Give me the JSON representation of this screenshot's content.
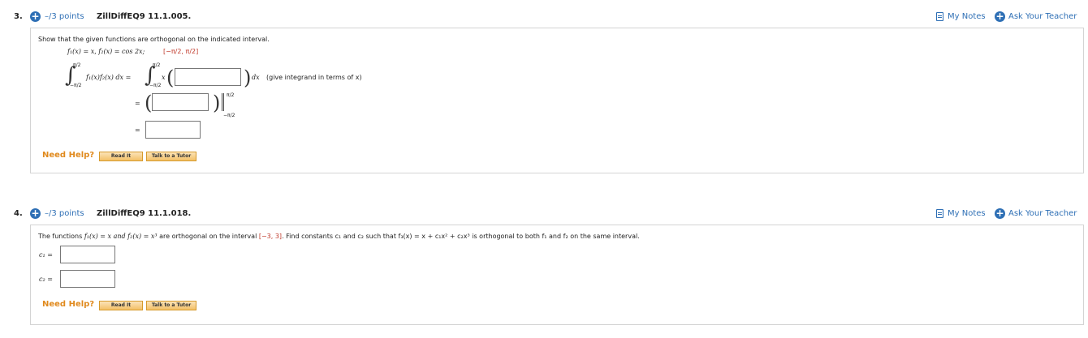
{
  "q3": {
    "number": "3.",
    "points": "–/3 points",
    "code": "ZillDiffEQ9 11.1.005.",
    "my_notes": "My Notes",
    "ask_teacher": "Ask Your Teacher",
    "prompt": "Show that the given functions are orthogonal on the indicated interval.",
    "functions": "f₁(x) = x, f₂(x) = cos 2x;",
    "interval": "[−π/2, π/2]",
    "upper_limit": "π/2",
    "lower_limit": "−π/2",
    "integrand_left": "f₁(x)f₂(x) dx =",
    "x_factor": "x",
    "dx": "dx",
    "hint": "(give integrand in terms of x)",
    "equals": "=",
    "eval_upper": "π/2",
    "eval_lower": "−π/2",
    "need_help": "Need Help?",
    "read_it": "Read It",
    "talk_tutor": "Talk to a Tutor"
  },
  "q4": {
    "number": "4.",
    "points": "–/3 points",
    "code": "ZillDiffEQ9 11.1.018.",
    "my_notes": "My Notes",
    "ask_teacher": "Ask Your Teacher",
    "prompt_a": "The functions ",
    "prompt_b": "f₁(x) = x and f₂(x) = x³",
    "prompt_c": " are orthogonal on the interval ",
    "prompt_interval": "[−3, 3]",
    "prompt_d": ". Find constants c₁ and c₂ such that f₃(x) = x + c₁x² + c₂x³ is orthogonal to both f₁ and f₂ on the same interval.",
    "c1_label": "c₁ =",
    "c2_label": "c₂ =",
    "need_help": "Need Help?",
    "read_it": "Read It",
    "talk_tutor": "Talk to a Tutor"
  },
  "colors": {
    "accent": "#2e6fb5",
    "help": "#e08a1e",
    "border": "#d4d4d4",
    "interval": "#c0392b"
  }
}
